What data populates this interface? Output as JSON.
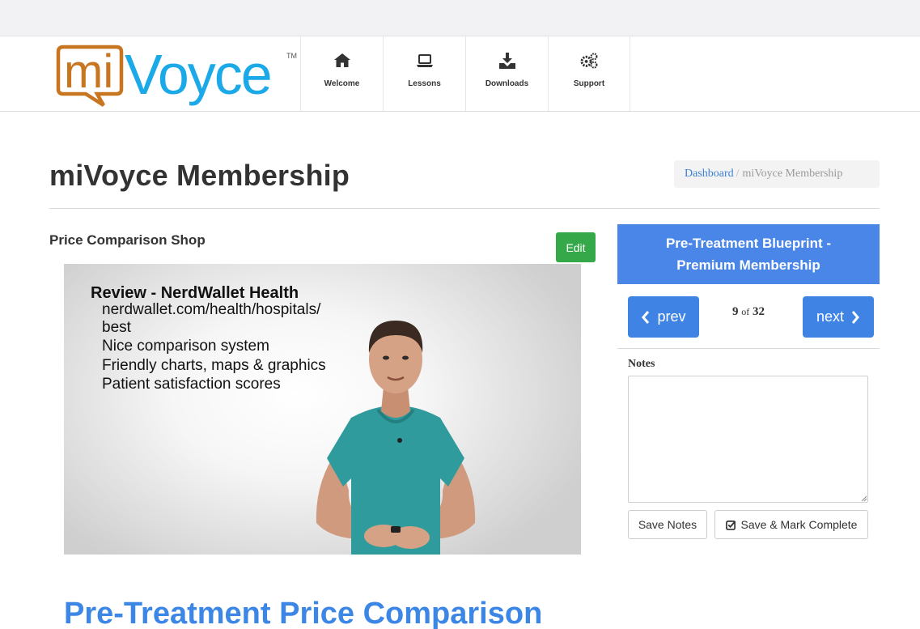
{
  "brand": {
    "logo_text_mi": "mi",
    "logo_text_voyce": "Voyce",
    "logo_tm": "TM",
    "color_orange": "#c8751f",
    "color_blue": "#1ba9e8"
  },
  "nav": {
    "items": [
      {
        "label": "Welcome",
        "icon": "home-icon"
      },
      {
        "label": "Lessons",
        "icon": "laptop-icon"
      },
      {
        "label": "Downloads",
        "icon": "download-icon"
      },
      {
        "label": "Support",
        "icon": "gears-icon"
      }
    ]
  },
  "page": {
    "title": "miVoyce Membership"
  },
  "breadcrumb": {
    "link": "Dashboard",
    "separator": "/",
    "current": "miVoyce Membership"
  },
  "lesson": {
    "title": "Price Comparison Shop",
    "edit_label": "Edit",
    "heading": "Pre-Treatment Price Comparison"
  },
  "video": {
    "slide_heading": "Review - NerdWallet Health",
    "slide_lines": [
      "nerdwallet.com/health/hospitals/",
      "best",
      "Nice comparison system",
      "Friendly charts, maps & graphics",
      "Patient satisfaction scores"
    ]
  },
  "sidebar": {
    "course_title": "Pre-Treatment Blueprint - Premium Membership",
    "prev_label": "prev",
    "next_label": "next",
    "current": "9",
    "of_label": "of",
    "total": "32",
    "notes_label": "Notes",
    "notes_value": "",
    "save_notes_label": "Save Notes",
    "save_complete_label": "Save & Mark Complete",
    "accent_color": "#4a86e8"
  }
}
